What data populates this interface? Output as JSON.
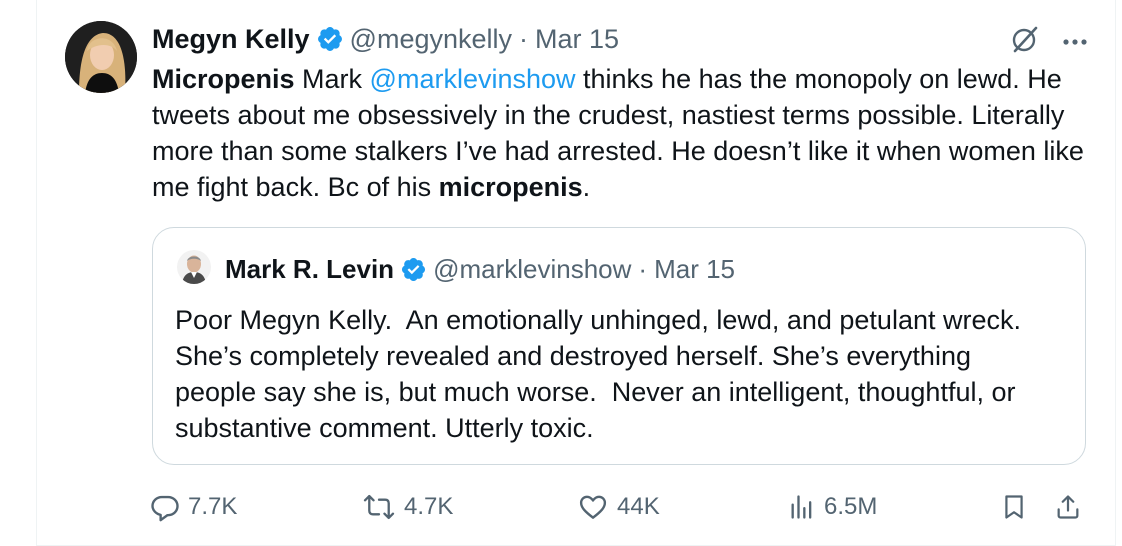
{
  "author": {
    "name": "Megyn Kelly",
    "handle": "@megynkelly",
    "separator": "·",
    "date": "Mar 15"
  },
  "tweet": {
    "bold_start": "Micropenis",
    "text_1": " Mark ",
    "mention": "@marklevinshow",
    "text_2": " thinks he has the monopoly on lewd. He tweets about me obsessively in the crudest, nastiest terms possible. Literally more than some stalkers I’ve had arrested. He doesn’t like it when women like me fight back. Bc of his ",
    "bold_end": "micropenis",
    "text_end": "."
  },
  "quote": {
    "name": "Mark R. Levin",
    "handle": "@marklevinshow",
    "separator": "·",
    "date": "Mar 15",
    "text": "Poor Megyn Kelly.  An emotionally unhinged, lewd, and petulant wreck.  She’s completely revealed and destroyed herself. She’s everything people say she is, but much worse.  Never an intelligent, thoughtful, or substantive comment. Utterly toxic."
  },
  "actions": {
    "replies": "7.7K",
    "reposts": "4.7K",
    "likes": "44K",
    "views": "6.5M"
  },
  "colors": {
    "link": "#1d9bf0",
    "verified": "#1d9bf0",
    "secondary_text": "#536471",
    "border": "#cfd9de"
  },
  "icons": [
    "verified-badge-icon",
    "grok-icon",
    "more-icon",
    "reply-icon",
    "repost-icon",
    "like-icon",
    "views-icon",
    "bookmark-icon",
    "share-icon"
  ]
}
